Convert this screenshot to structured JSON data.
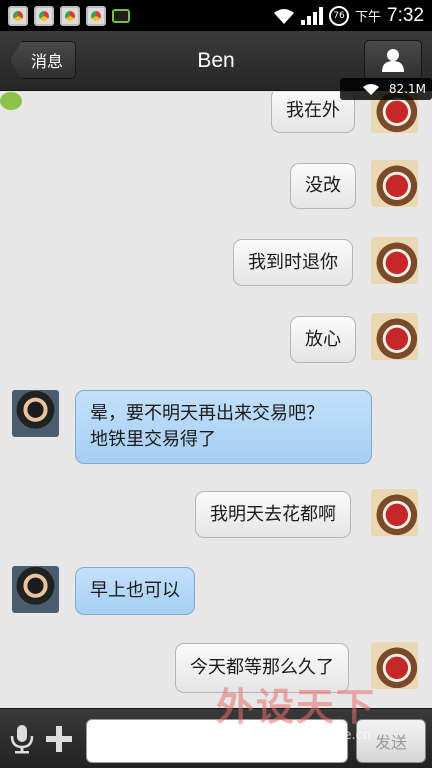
{
  "status_bar": {
    "ampm": "下午",
    "time": "7:32",
    "battery_pct": "76",
    "icons": [
      "chat-notification-icon",
      "app-icon",
      "app-icon",
      "app-icon",
      "app-icon",
      "battery-icon"
    ]
  },
  "header": {
    "back_label": "消息",
    "title": "Ben",
    "profile_icon": "person-icon"
  },
  "network_badge": {
    "speed": "82.1M",
    "icon": "wifi-icon"
  },
  "messages": [
    {
      "side": "out",
      "text": "我在外"
    },
    {
      "side": "out",
      "text": "没改"
    },
    {
      "side": "out",
      "text": "我到时退你"
    },
    {
      "side": "out",
      "text": "放心"
    },
    {
      "side": "in",
      "lines": [
        "晕，要不明天再出来交易吧？",
        "地铁里交易得了"
      ]
    },
    {
      "side": "out",
      "text": "我明天去花都啊"
    },
    {
      "side": "in",
      "text": "早上也可以"
    },
    {
      "side": "out",
      "text": "今天都等那么久了"
    }
  ],
  "input_bar": {
    "mic_icon": "microphone-icon",
    "plus_icon": "plus-icon",
    "input_value": "",
    "send_label": "发送"
  },
  "watermark": {
    "brand": "外设天下",
    "url": "www.pcwaishe.cn"
  },
  "colors": {
    "incoming_bubble": "#b3d6f7",
    "outgoing_bubble": "#f2f2f2",
    "background": "#e7e7e7",
    "header": "#2e2e2e"
  }
}
